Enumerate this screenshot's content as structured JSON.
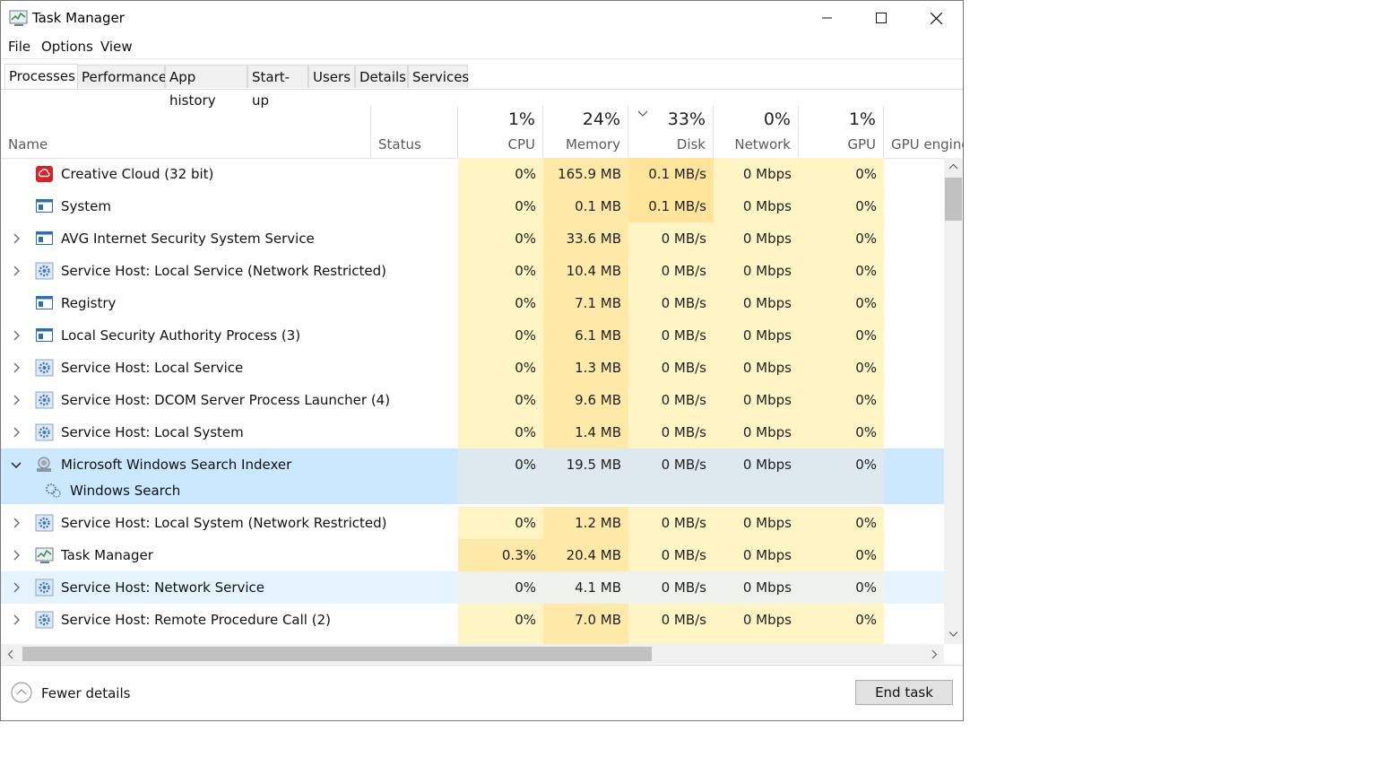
{
  "window": {
    "title": "Task Manager"
  },
  "menu": [
    "File",
    "Options",
    "View"
  ],
  "tabs": [
    "Processes",
    "Performance",
    "App history",
    "Start-up",
    "Users",
    "Details",
    "Services"
  ],
  "columns": {
    "name": "Name",
    "status": "Status",
    "cpu": {
      "pct": "1%",
      "label": "CPU"
    },
    "memory": {
      "pct": "24%",
      "label": "Memory"
    },
    "disk": {
      "pct": "33%",
      "label": "Disk"
    },
    "network": {
      "pct": "0%",
      "label": "Network"
    },
    "gpu": {
      "pct": "1%",
      "label": "GPU"
    },
    "gpu_engine": {
      "label": "GPU engine"
    }
  },
  "processes": [
    {
      "name": "Creative Cloud (32 bit)",
      "cpu": "0%",
      "memory": "165.9 MB",
      "disk": "0.1 MB/s",
      "network": "0 Mbps",
      "gpu": "0%",
      "icon": "creative-cloud-icon",
      "expandable": false
    },
    {
      "name": "System",
      "cpu": "0%",
      "memory": "0.1 MB",
      "disk": "0.1 MB/s",
      "network": "0 Mbps",
      "gpu": "0%",
      "icon": "window-app-icon",
      "expandable": false
    },
    {
      "name": "AVG Internet Security System  Service",
      "cpu": "0%",
      "memory": "33.6 MB",
      "disk": "0 MB/s",
      "network": "0 Mbps",
      "gpu": "0%",
      "icon": "window-app-icon",
      "expandable": true
    },
    {
      "name": "Service Host: Local Service (Network Restricted)",
      "cpu": "0%",
      "memory": "10.4 MB",
      "disk": "0 MB/s",
      "network": "0 Mbps",
      "gpu": "0%",
      "icon": "gear-icon",
      "expandable": true
    },
    {
      "name": "Registry",
      "cpu": "0%",
      "memory": "7.1 MB",
      "disk": "0 MB/s",
      "network": "0 Mbps",
      "gpu": "0%",
      "icon": "window-app-icon",
      "expandable": false
    },
    {
      "name": "Local Security Authority Process (3)",
      "cpu": "0%",
      "memory": "6.1 MB",
      "disk": "0 MB/s",
      "network": "0 Mbps",
      "gpu": "0%",
      "icon": "window-app-icon",
      "expandable": true
    },
    {
      "name": "Service Host: Local Service",
      "cpu": "0%",
      "memory": "1.3 MB",
      "disk": "0 MB/s",
      "network": "0 Mbps",
      "gpu": "0%",
      "icon": "gear-icon",
      "expandable": true
    },
    {
      "name": "Service Host: DCOM Server Process Launcher (4)",
      "cpu": "0%",
      "memory": "9.6 MB",
      "disk": "0 MB/s",
      "network": "0 Mbps",
      "gpu": "0%",
      "icon": "gear-icon",
      "expandable": true
    },
    {
      "name": "Service Host: Local System",
      "cpu": "0%",
      "memory": "1.4 MB",
      "disk": "0 MB/s",
      "network": "0 Mbps",
      "gpu": "0%",
      "icon": "gear-icon",
      "expandable": true
    },
    {
      "name": "Microsoft Windows Search Indexer",
      "cpu": "0%",
      "memory": "19.5 MB",
      "disk": "0 MB/s",
      "network": "0 Mbps",
      "gpu": "0%",
      "icon": "search-indexer-icon",
      "expandable": true,
      "expanded": true,
      "selected": true,
      "children": [
        "Windows Search"
      ]
    },
    {
      "name": "Service Host: Local System (Network Restricted)",
      "cpu": "0%",
      "memory": "1.2 MB",
      "disk": "0 MB/s",
      "network": "0 Mbps",
      "gpu": "0%",
      "icon": "gear-icon",
      "expandable": true
    },
    {
      "name": "Task Manager",
      "cpu": "0.3%",
      "memory": "20.4 MB",
      "disk": "0 MB/s",
      "network": "0 Mbps",
      "gpu": "0%",
      "icon": "task-manager-icon",
      "expandable": true
    },
    {
      "name": "Service Host: Network Service",
      "cpu": "0%",
      "memory": "4.1 MB",
      "disk": "0 MB/s",
      "network": "0 Mbps",
      "gpu": "0%",
      "icon": "gear-icon",
      "expandable": true,
      "hover": true
    },
    {
      "name": "Service Host: Remote Procedure Call (2)",
      "cpu": "0%",
      "memory": "7.0 MB",
      "disk": "0 MB/s",
      "network": "0 Mbps",
      "gpu": "0%",
      "icon": "gear-icon",
      "expandable": true
    }
  ],
  "footer": {
    "fewer_details": "Fewer details",
    "end_task": "End task"
  },
  "colors": {
    "selected": "#cce8ff",
    "heat_low": "#fff4c4",
    "heat_mid": "#ffe9a8"
  }
}
